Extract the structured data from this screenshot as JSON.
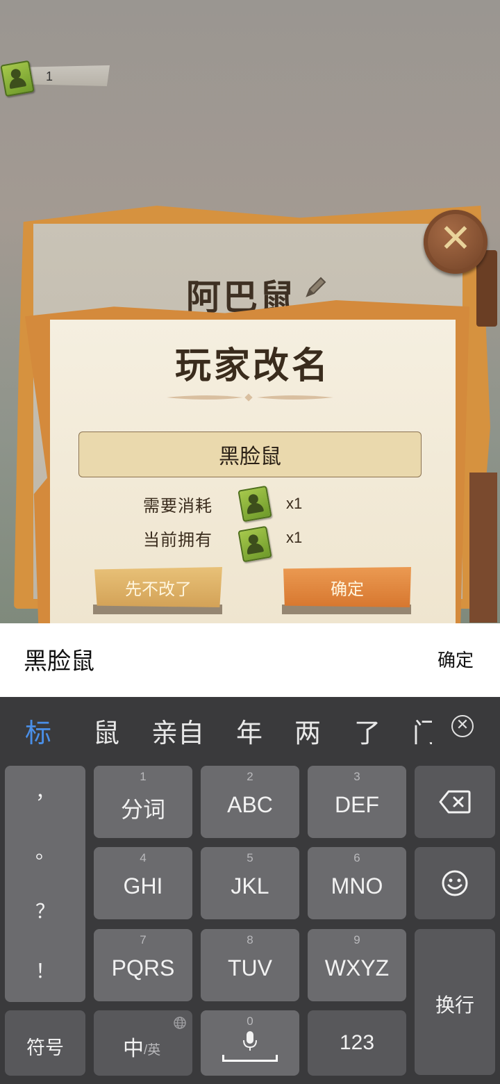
{
  "hud": {
    "rename_ticket_count": "1"
  },
  "profile": {
    "name": "阿巴鼠"
  },
  "dialog": {
    "title": "玩家改名",
    "name_input_value": "黑脸鼠",
    "cost_label": "需要消耗",
    "cost_qty": "x1",
    "owned_label": "当前拥有",
    "owned_qty": "x1",
    "cancel_label": "先不改了",
    "confirm_label": "确定"
  },
  "ime": {
    "composing_text": "黑脸鼠",
    "confirm_label": "确定",
    "candidates": [
      "标",
      "鼠",
      "亲自",
      "年",
      "两",
      "了",
      "门"
    ]
  },
  "keyboard": {
    "punctuation": [
      "，",
      "。",
      "？",
      "！"
    ],
    "keys": [
      {
        "num": "1",
        "label": "分词"
      },
      {
        "num": "2",
        "label": "ABC"
      },
      {
        "num": "3",
        "label": "DEF"
      },
      {
        "num": "4",
        "label": "GHI"
      },
      {
        "num": "5",
        "label": "JKL"
      },
      {
        "num": "6",
        "label": "MNO"
      },
      {
        "num": "7",
        "label": "PQRS"
      },
      {
        "num": "8",
        "label": "TUV"
      },
      {
        "num": "9",
        "label": "WXYZ"
      }
    ],
    "symbols_label": "符号",
    "lang_label": "中",
    "lang_alt_label": "/英",
    "space_num": "0",
    "numbers_label": "123",
    "enter_label": "换行"
  },
  "colors": {
    "candidate_active": "#4a8fe8",
    "confirm_button": "#d7772f",
    "cancel_button": "#d3a257"
  }
}
